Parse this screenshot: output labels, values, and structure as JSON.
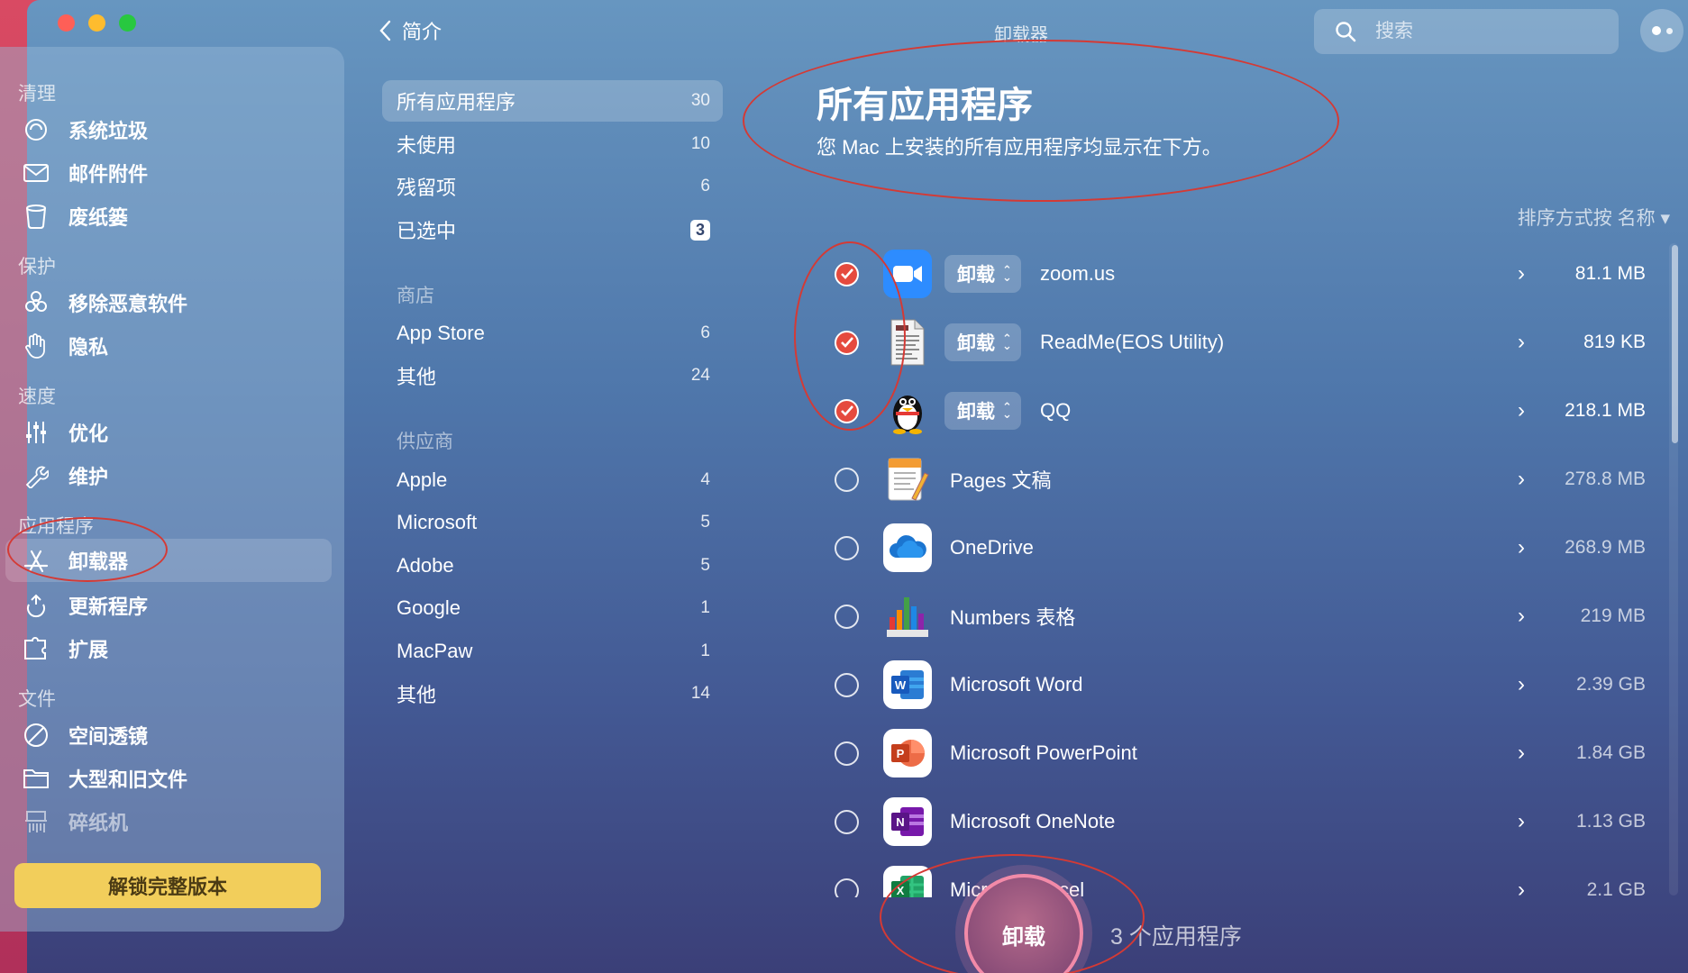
{
  "window": {
    "title": "卸载器",
    "back_label": "简介"
  },
  "search": {
    "placeholder": "搜索"
  },
  "sidebar": {
    "sections": [
      {
        "title": "清理",
        "items": [
          {
            "label": "系统垃圾",
            "icon": "broom-icon"
          },
          {
            "label": "邮件附件",
            "icon": "envelope-icon"
          },
          {
            "label": "废纸篓",
            "icon": "trash-icon"
          }
        ]
      },
      {
        "title": "保护",
        "items": [
          {
            "label": "移除恶意软件",
            "icon": "biohazard-icon"
          },
          {
            "label": "隐私",
            "icon": "hand-icon"
          }
        ]
      },
      {
        "title": "速度",
        "items": [
          {
            "label": "优化",
            "icon": "sliders-icon"
          },
          {
            "label": "维护",
            "icon": "wrench-icon"
          }
        ]
      },
      {
        "title": "应用程序",
        "items": [
          {
            "label": "卸载器",
            "icon": "app-store-icon",
            "active": true
          },
          {
            "label": "更新程序",
            "icon": "update-arrow-icon"
          },
          {
            "label": "扩展",
            "icon": "puzzle-icon"
          }
        ]
      },
      {
        "title": "文件",
        "items": [
          {
            "label": "空间透镜",
            "icon": "lens-icon"
          },
          {
            "label": "大型和旧文件",
            "icon": "folder-icon"
          },
          {
            "label": "碎纸机",
            "icon": "shredder-icon"
          }
        ]
      }
    ],
    "unlock_label": "解锁完整版本"
  },
  "categories": {
    "main": [
      {
        "label": "所有应用程序",
        "count": "30",
        "active": true
      },
      {
        "label": "未使用",
        "count": "10"
      },
      {
        "label": "残留项",
        "count": "6"
      },
      {
        "label": "已选中",
        "count": "3"
      }
    ],
    "store_title": "商店",
    "store": [
      {
        "label": "App Store",
        "count": "6"
      },
      {
        "label": "其他",
        "count": "24"
      }
    ],
    "vendor_title": "供应商",
    "vendors": [
      {
        "label": "Apple",
        "count": "4"
      },
      {
        "label": "Microsoft",
        "count": "5"
      },
      {
        "label": "Adobe",
        "count": "5"
      },
      {
        "label": "Google",
        "count": "1"
      },
      {
        "label": "MacPaw",
        "count": "1"
      },
      {
        "label": "其他",
        "count": "14"
      }
    ]
  },
  "main": {
    "title": "所有应用程序",
    "subtitle": "您 Mac 上安装的所有应用程序均显示在下方。",
    "sort_label": "排序方式按 名称 ▾",
    "uninstall_pill": "卸载"
  },
  "apps": [
    {
      "name": "zoom.us",
      "size": "81.1 MB",
      "checked": true,
      "icon": "zoom-icon"
    },
    {
      "name": "ReadMe(EOS Utility)",
      "size": "819 KB",
      "checked": true,
      "icon": "document-icon"
    },
    {
      "name": "QQ",
      "size": "218.1 MB",
      "checked": true,
      "icon": "qq-penguin-icon"
    },
    {
      "name": "Pages 文稿",
      "size": "278.8 MB",
      "checked": false,
      "icon": "pages-icon"
    },
    {
      "name": "OneDrive",
      "size": "268.9 MB",
      "checked": false,
      "icon": "onedrive-cloud-icon"
    },
    {
      "name": "Numbers 表格",
      "size": "219 MB",
      "checked": false,
      "icon": "numbers-chart-icon"
    },
    {
      "name": "Microsoft Word",
      "size": "2.39 GB",
      "checked": false,
      "icon": "word-icon"
    },
    {
      "name": "Microsoft PowerPoint",
      "size": "1.84 GB",
      "checked": false,
      "icon": "powerpoint-icon"
    },
    {
      "name": "Microsoft OneNote",
      "size": "1.13 GB",
      "checked": false,
      "icon": "onenote-icon"
    },
    {
      "name": "Microsoft Excel",
      "size": "2.1 GB",
      "checked": false,
      "icon": "excel-icon"
    }
  ],
  "footer": {
    "uninstall_button": "卸载",
    "selected_count": "3 个应用程序"
  },
  "colors": {
    "accent_red": "#e54a3e",
    "unlock_yellow": "#f2ce5b",
    "annotation_red": "#d43a35"
  }
}
